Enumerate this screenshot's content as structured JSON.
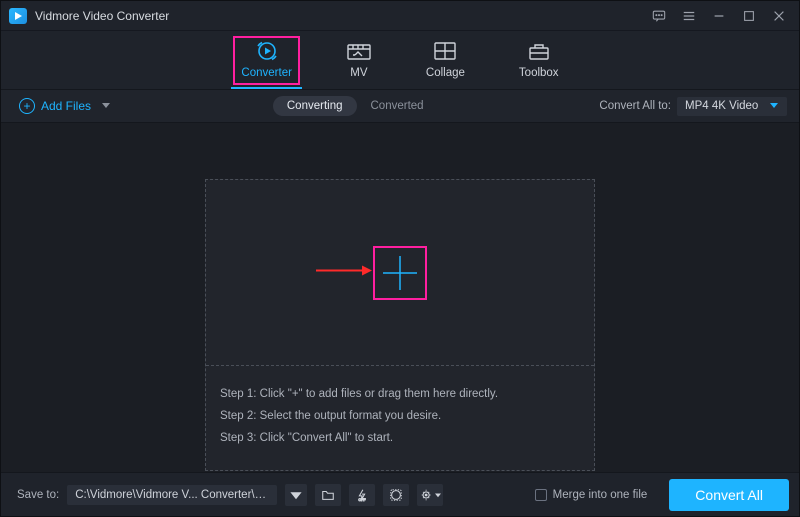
{
  "app": {
    "title": "Vidmore Video Converter"
  },
  "tabs": {
    "items": [
      {
        "label": "Converter",
        "icon": "converter-icon",
        "active": true
      },
      {
        "label": "MV",
        "icon": "mv-icon",
        "active": false
      },
      {
        "label": "Collage",
        "icon": "collage-icon",
        "active": false
      },
      {
        "label": "Toolbox",
        "icon": "toolbox-icon",
        "active": false
      }
    ]
  },
  "options": {
    "add_files_label": "Add Files",
    "toggle": {
      "converting": "Converting",
      "converted": "Converted",
      "active": "converting"
    },
    "convert_all_to_label": "Convert All to:",
    "output_format": "MP4 4K Video"
  },
  "dropzone": {
    "step1": "Step 1: Click \"+\" to add files or drag them here directly.",
    "step2": "Step 2: Select the output format you desire.",
    "step3": "Step 3: Click \"Convert All\" to start."
  },
  "footer": {
    "save_to_label": "Save to:",
    "path": "C:\\Vidmore\\Vidmore V... Converter\\Converted",
    "merge_label": "Merge into one file",
    "convert_all_label": "Convert All"
  }
}
